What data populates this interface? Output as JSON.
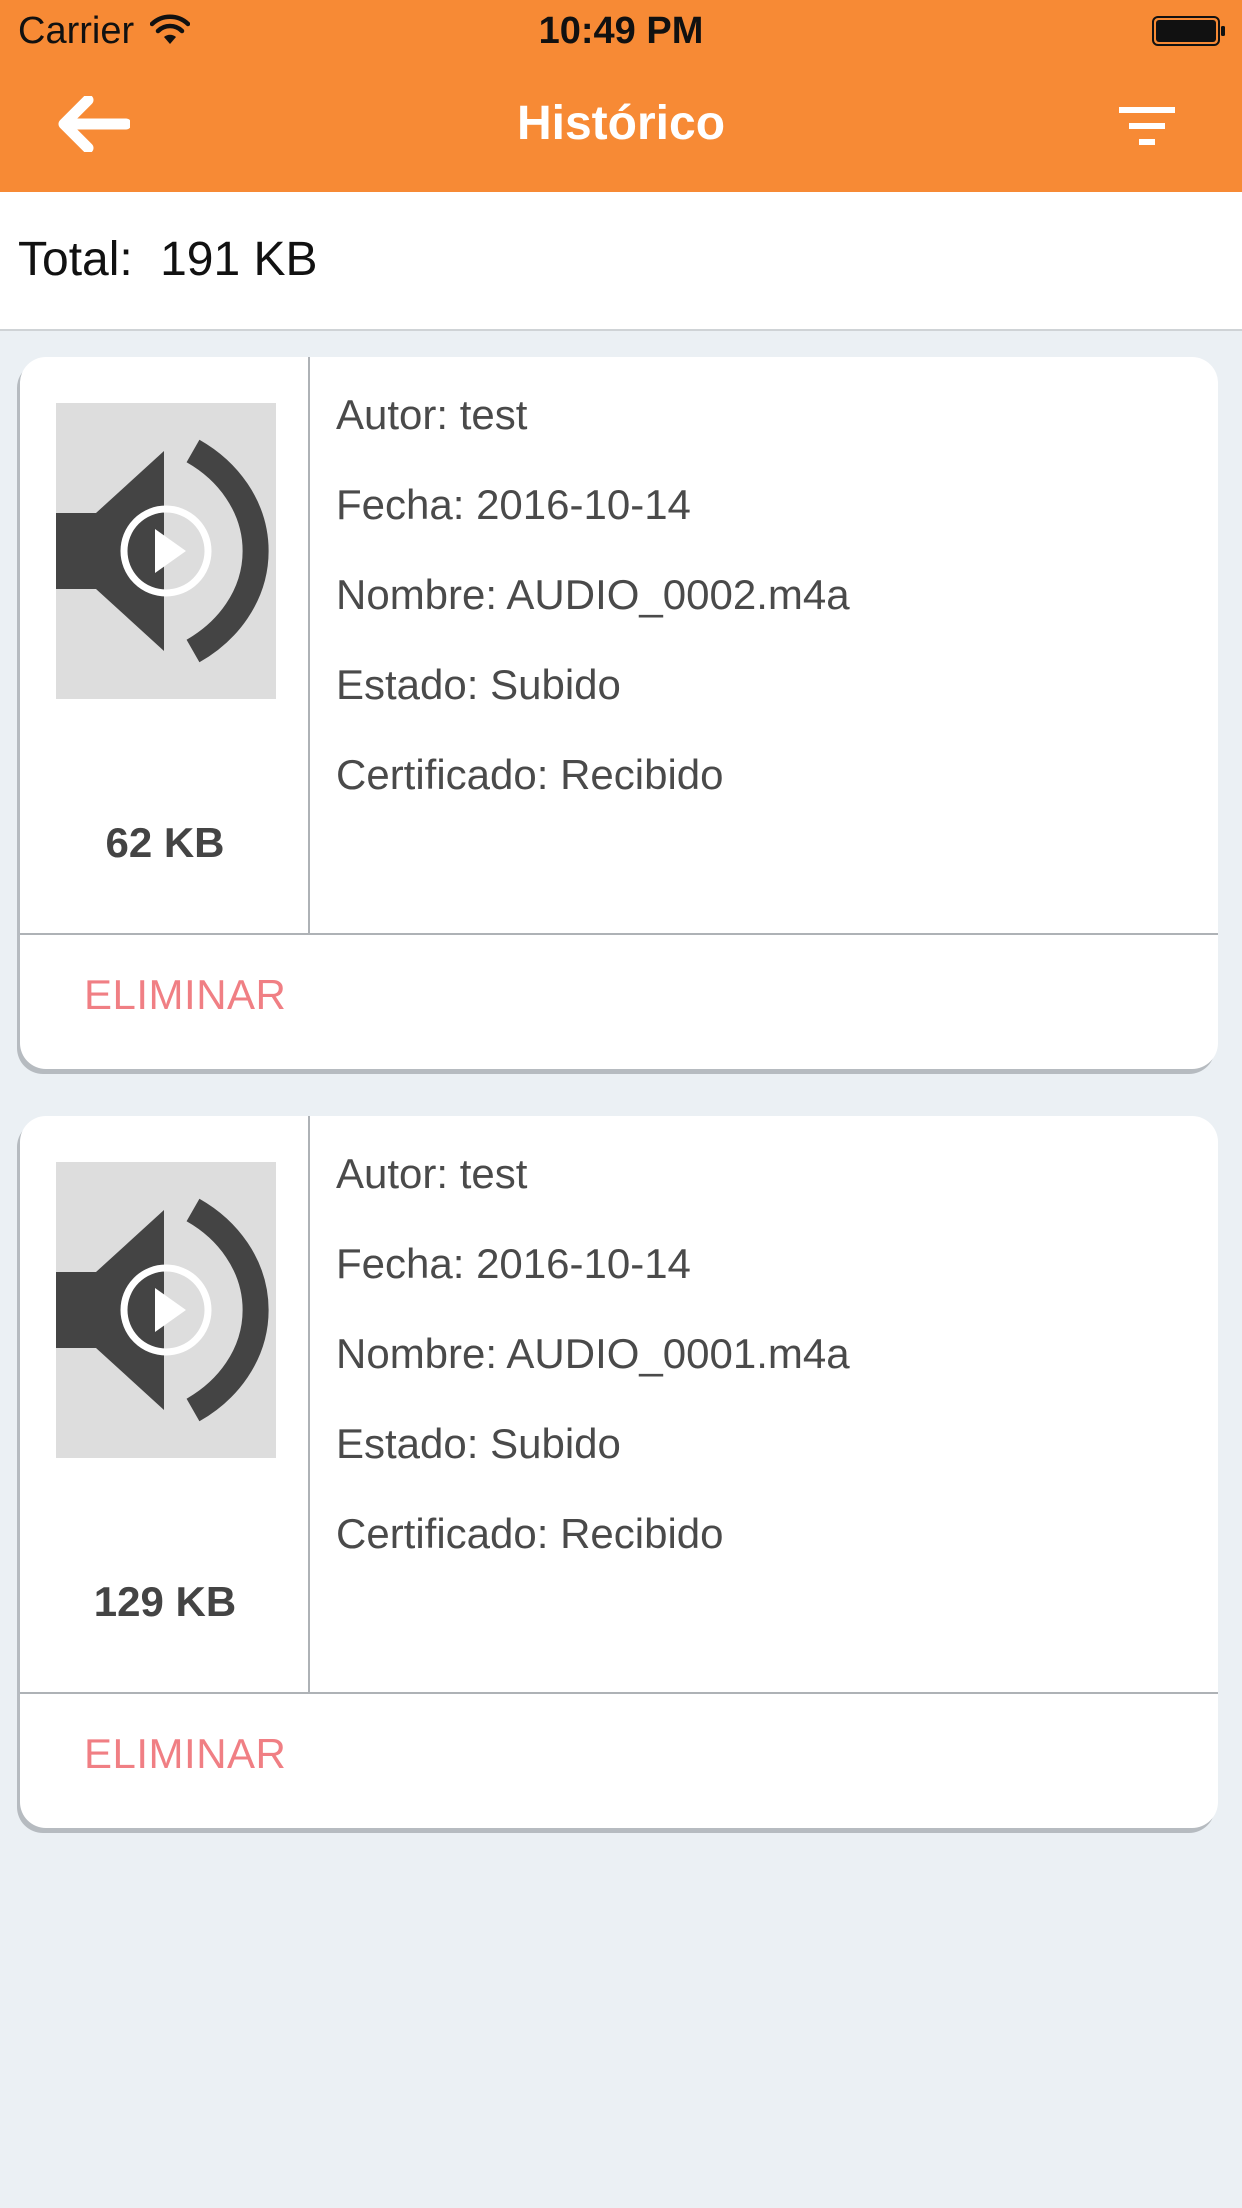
{
  "status_bar": {
    "carrier": "Carrier",
    "time": "10:49 PM"
  },
  "nav": {
    "title": "Histórico",
    "back_icon": "arrow-left-icon",
    "filter_icon": "filter-icon"
  },
  "total": {
    "label": "Total:",
    "value": "191 KB"
  },
  "items": [
    {
      "size": "62 KB",
      "autor": "Autor: test",
      "fecha": "Fecha: 2016-10-14",
      "nombre": "Nombre: AUDIO_0002.m4a",
      "estado": "Estado: Subido",
      "certificado": "Certificado: Recibido",
      "delete_label": "ELIMINAR"
    },
    {
      "size": "129 KB",
      "autor": "Autor: test",
      "fecha": "Fecha: 2016-10-14",
      "nombre": "Nombre: AUDIO_0001.m4a",
      "estado": "Estado: Subido",
      "certificado": "Certificado: Recibido",
      "delete_label": "ELIMINAR"
    }
  ],
  "colors": {
    "header": "#f78a35",
    "delete": "#f07f84",
    "background": "#ebf0f4"
  }
}
